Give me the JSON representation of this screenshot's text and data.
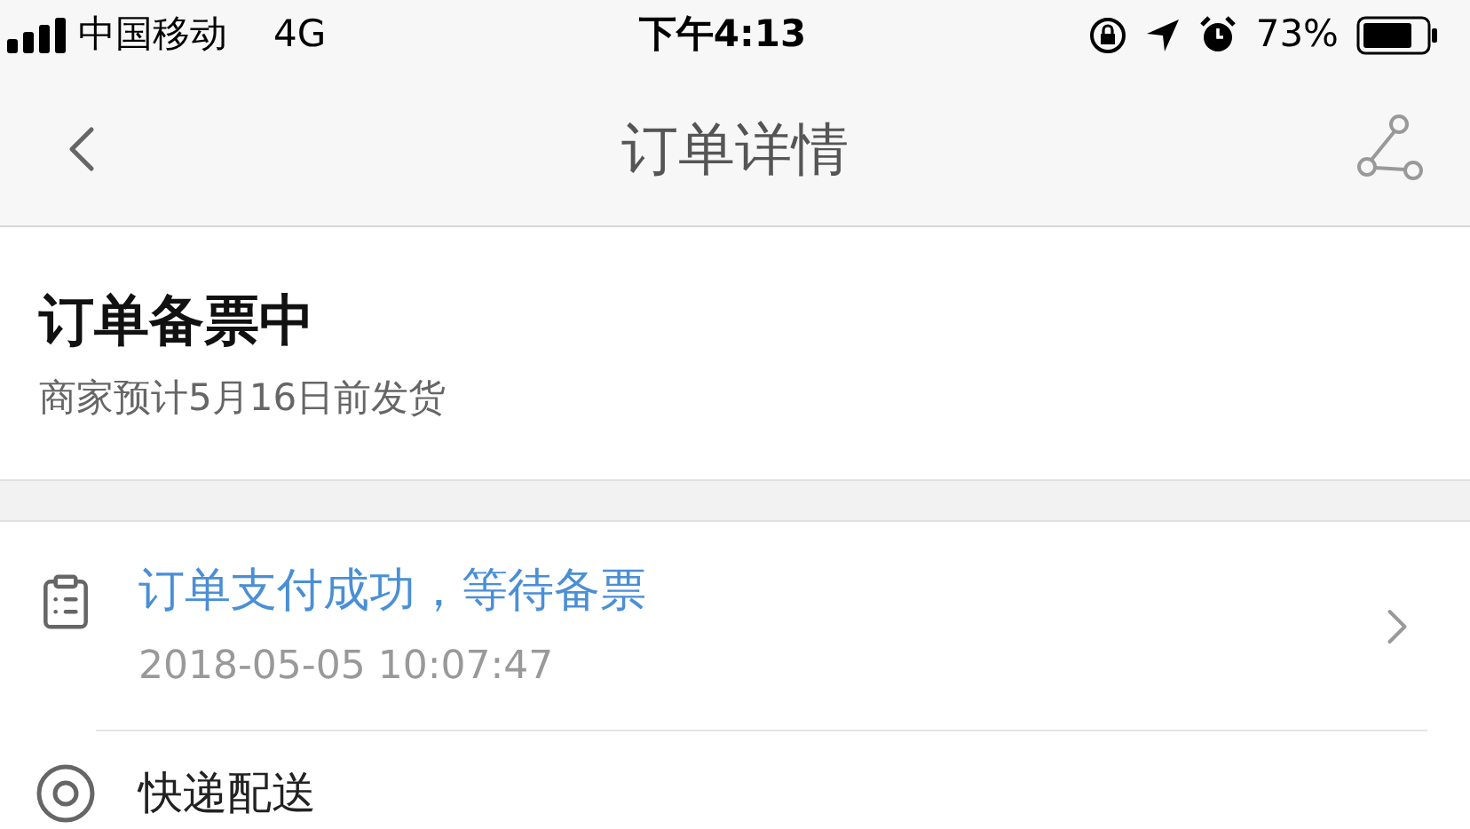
{
  "status_bar": {
    "carrier": "中国移动",
    "network": "4G",
    "time": "下午4:13",
    "battery": "73%"
  },
  "nav_bar": {
    "title": "订单详情"
  },
  "order_status": {
    "title": "订单备票中",
    "subtitle": "商家预计5月16日前发货"
  },
  "timeline": [
    {
      "kind": "log",
      "title": "订单支付成功，等待备票",
      "time": "2018-05-05 10:07:47"
    },
    {
      "kind": "delivery",
      "title": "快递配送"
    }
  ]
}
